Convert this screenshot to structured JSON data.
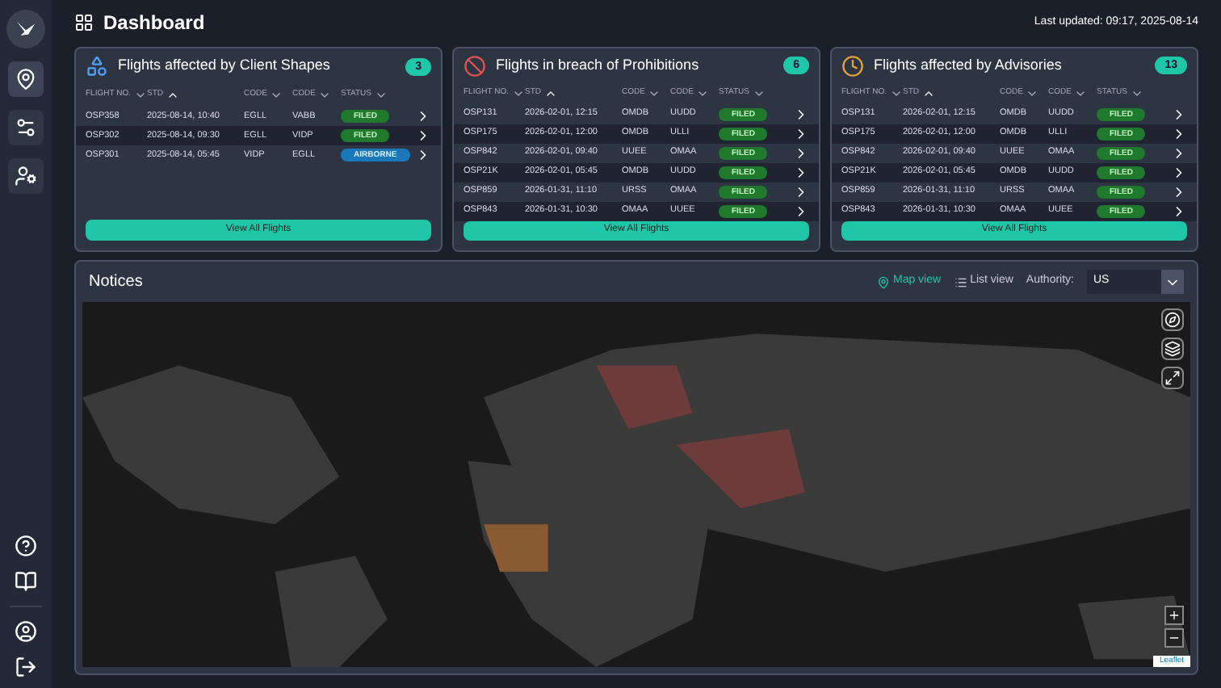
{
  "header": {
    "title": "Dashboard",
    "last_updated": "Last updated: 09:17, 2025-08-14"
  },
  "sidebar": {
    "items": [
      {
        "selected": true
      },
      {
        "selected": false
      },
      {
        "selected": false
      }
    ]
  },
  "cards": [
    {
      "title": "Flights affected by Client Shapes",
      "count": "3",
      "columns": [
        "FLIGHT NO.",
        "STD",
        "CODE",
        "CODE",
        "STATUS"
      ],
      "button": "View All Flights",
      "rows": [
        {
          "flight": "OSP358",
          "std": "2025-08-14, 10:40",
          "code_1": "EGLL",
          "code_2": "VABB",
          "status": "FILED",
          "kind": "filed"
        },
        {
          "flight": "OSP302",
          "std": "2025-08-14, 09:30",
          "code_1": "EGLL",
          "code_2": "VIDP",
          "status": "FILED",
          "kind": "filed"
        },
        {
          "flight": "OSP301",
          "std": "2025-08-14, 05:45",
          "code_1": "VIDP",
          "code_2": "EGLL",
          "status": "AIRBORNE",
          "kind": "airborne"
        }
      ]
    },
    {
      "title": "Flights in breach of Prohibitions",
      "count": "6",
      "columns": [
        "FLIGHT NO.",
        "STD",
        "CODE",
        "CODE",
        "STATUS"
      ],
      "button": "View All Flights",
      "rows": [
        {
          "flight": "OSP131",
          "std": "2026-02-01, 12:15",
          "code_1": "OMDB",
          "code_2": "UUDD",
          "status": "FILED",
          "kind": "filed"
        },
        {
          "flight": "OSP175",
          "std": "2026-02-01, 12:00",
          "code_1": "OMDB",
          "code_2": "ULLI",
          "status": "FILED",
          "kind": "filed"
        },
        {
          "flight": "OSP842",
          "std": "2026-02-01, 09:40",
          "code_1": "UUEE",
          "code_2": "OMAA",
          "status": "FILED",
          "kind": "filed"
        },
        {
          "flight": "OSP21K",
          "std": "2026-02-01, 05:45",
          "code_1": "OMDB",
          "code_2": "UUDD",
          "status": "FILED",
          "kind": "filed"
        },
        {
          "flight": "OSP859",
          "std": "2026-01-31, 11:10",
          "code_1": "URSS",
          "code_2": "OMAA",
          "status": "FILED",
          "kind": "filed"
        },
        {
          "flight": "OSP843",
          "std": "2026-01-31, 10:30",
          "code_1": "OMAA",
          "code_2": "UUEE",
          "status": "FILED",
          "kind": "filed"
        }
      ]
    },
    {
      "title": "Flights affected by Advisories",
      "count": "13",
      "columns": [
        "FLIGHT NO.",
        "STD",
        "CODE",
        "CODE",
        "STATUS"
      ],
      "button": "View All Flights",
      "rows": [
        {
          "flight": "OSP131",
          "std": "2026-02-01, 12:15",
          "code_1": "OMDB",
          "code_2": "UUDD",
          "status": "FILED",
          "kind": "filed"
        },
        {
          "flight": "OSP175",
          "std": "2026-02-01, 12:00",
          "code_1": "OMDB",
          "code_2": "ULLI",
          "status": "FILED",
          "kind": "filed"
        },
        {
          "flight": "OSP842",
          "std": "2026-02-01, 09:40",
          "code_1": "UUEE",
          "code_2": "OMAA",
          "status": "FILED",
          "kind": "filed"
        },
        {
          "flight": "OSP21K",
          "std": "2026-02-01, 05:45",
          "code_1": "OMDB",
          "code_2": "UUDD",
          "status": "FILED",
          "kind": "filed"
        },
        {
          "flight": "OSP859",
          "std": "2026-01-31, 11:10",
          "code_1": "URSS",
          "code_2": "OMAA",
          "status": "FILED",
          "kind": "filed"
        },
        {
          "flight": "OSP843",
          "std": "2026-01-31, 10:30",
          "code_1": "OMAA",
          "code_2": "UUEE",
          "status": "FILED",
          "kind": "filed"
        }
      ]
    }
  ],
  "notices": {
    "title": "Notices",
    "views": [
      {
        "label": "Map view",
        "selected": true
      },
      {
        "label": "List view",
        "selected": false
      }
    ],
    "authority": {
      "label": "Authority:",
      "value": "US"
    },
    "attribution": "Leaflet"
  }
}
